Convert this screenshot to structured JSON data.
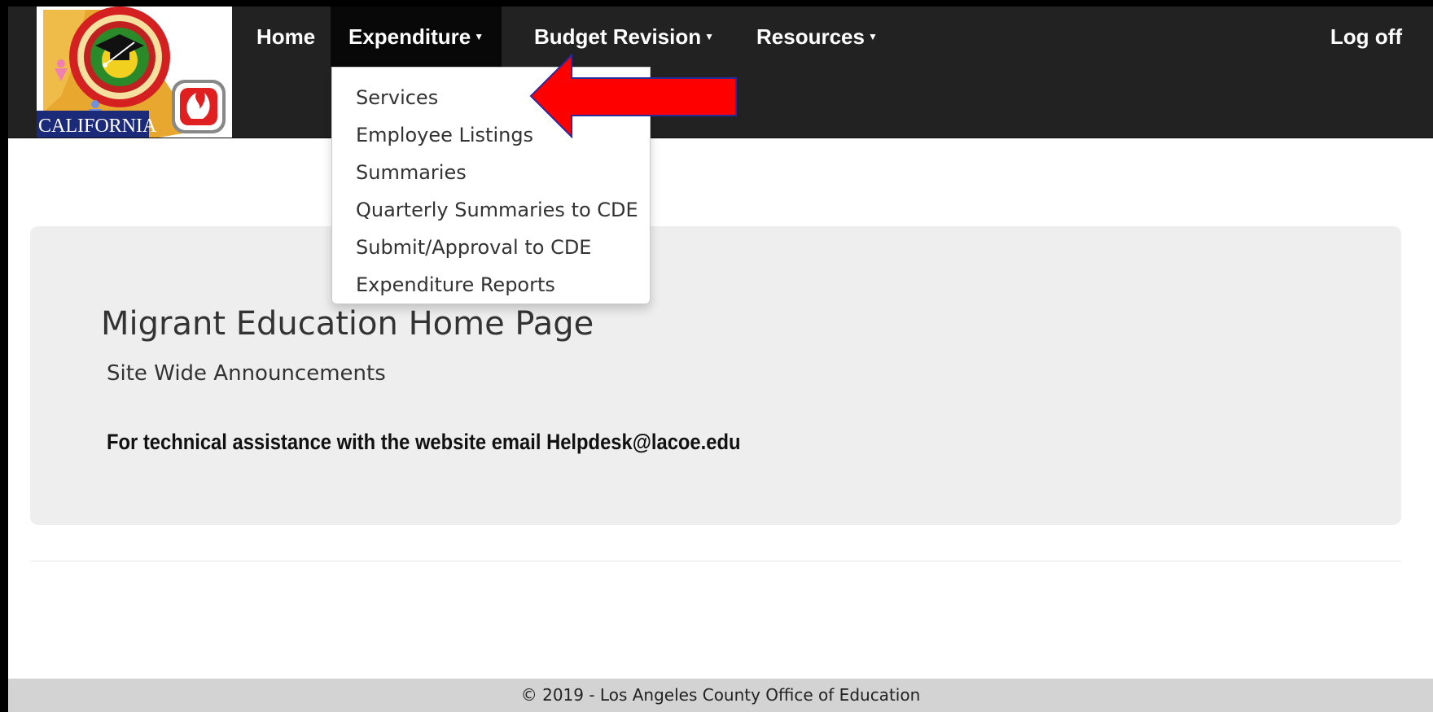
{
  "navbar": {
    "logo_text": "CALIFORNIA",
    "items": [
      {
        "label": "Home",
        "has_caret": false
      },
      {
        "label": "Expenditure",
        "has_caret": true,
        "active": true
      },
      {
        "label": "Budget Revision",
        "has_caret": true
      },
      {
        "label": "Resources",
        "has_caret": true
      }
    ],
    "logoff_label": "Log off",
    "caret_icon": "caret-down-icon"
  },
  "dropdown": {
    "items": [
      "Services",
      "Employee Listings",
      "Summaries",
      "Quarterly Summaries to CDE",
      "Submit/Approval to CDE",
      "Expenditure Reports"
    ]
  },
  "main": {
    "title": "Migrant Education Home Page",
    "subtitle": "Site Wide Announcements",
    "help_text": "For technical assistance with the website email Helpdesk@lacoe.edu"
  },
  "footer": {
    "text": "© 2019 - Los Angeles County Office of Education"
  },
  "colors": {
    "navbar_bg": "#222222",
    "active_bg": "#080808",
    "jumbotron_bg": "#eeeeee",
    "footer_bg": "#d3d3d3",
    "annotation_arrow": "#ff0000"
  }
}
